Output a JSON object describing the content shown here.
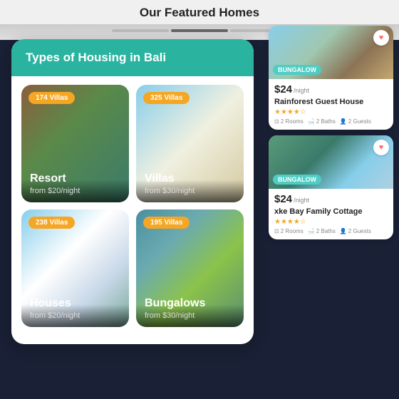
{
  "page": {
    "title": "Our Featured Homes",
    "background_color": "#1a2035"
  },
  "left_panel": {
    "header": "Types of Housing in Bali",
    "header_color": "#2ab4a0",
    "housing_types": [
      {
        "id": "resort",
        "name": "Resort",
        "price": "from $20/night",
        "villas_count": "174 Villas",
        "scene_class": "resort-scene"
      },
      {
        "id": "villas",
        "name": "Villas",
        "price": "from $30/night",
        "villas_count": "325 Villas",
        "scene_class": "villas-scene"
      },
      {
        "id": "houses",
        "name": "Houses",
        "price": "from $20/night",
        "villas_count": "238 Villas",
        "scene_class": "houses-scene"
      },
      {
        "id": "bungalows",
        "name": "Bungalows",
        "price": "from $30/night",
        "villas_count": "195 Villas",
        "scene_class": "bungalows-scene"
      }
    ]
  },
  "right_panel": {
    "cards": [
      {
        "id": "card1",
        "price_main": "$24",
        "price_suffix": "/night",
        "badge": "Bungalow",
        "badge_color": "#4ecdc4",
        "title": "Rainforest Guest House",
        "stars": 4,
        "rooms": "2 Rooms",
        "baths": "2 Baths",
        "guests": "2 Guests",
        "has_heart": true,
        "scene_class": "prop-img-1"
      },
      {
        "id": "card2",
        "price_main": "$24",
        "price_suffix": "/night",
        "badge": "Bungalow",
        "badge_color": "#4ecdc4",
        "title": "xke Bay Family Cottage",
        "stars": 4,
        "rooms": "2 Rooms",
        "baths": "2 Baths",
        "guests": "2 Guests",
        "has_heart": true,
        "scene_class": "prop-img-2"
      }
    ]
  },
  "icons": {
    "heart": "♥",
    "bed": "🛏",
    "bath": "🛁",
    "person": "👤",
    "star": "★",
    "star_empty": "☆"
  }
}
